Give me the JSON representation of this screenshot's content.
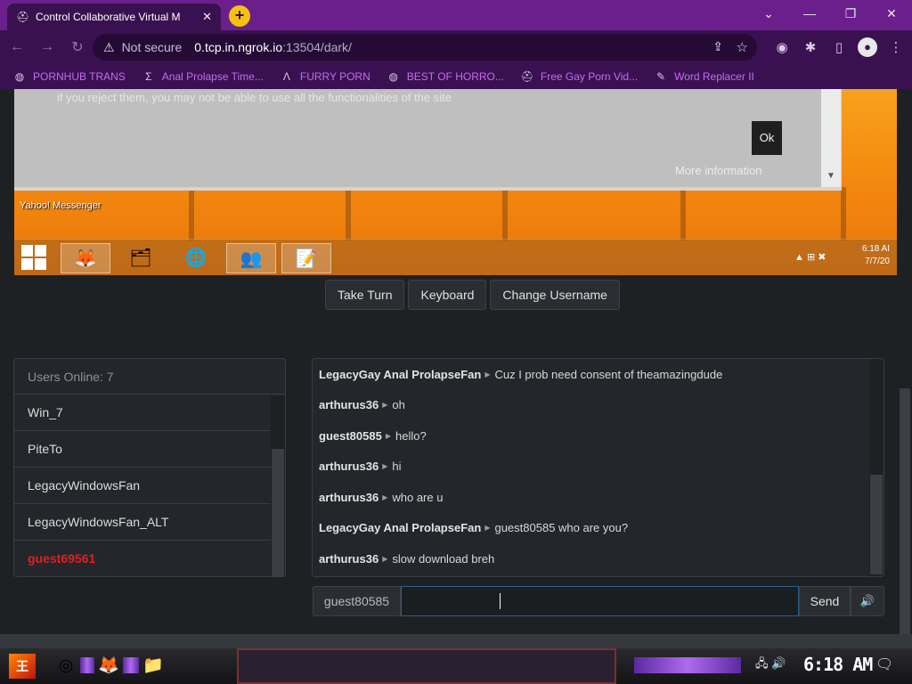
{
  "browser": {
    "tab_title": "Control Collaborative Virtual M",
    "tab_favicon": "hat-icon",
    "new_tab": "+",
    "window_controls": [
      "⌄",
      "—",
      "❐",
      "✕"
    ],
    "security": "Not secure",
    "url_host": "0.tcp.in.ngrok.io",
    "url_path": ":13504/dark/",
    "bookmarks": [
      {
        "label": "PORNHUB TRANS",
        "icon": "globe-icon"
      },
      {
        "label": "Anal Prolapse Time...",
        "icon": "sigma-icon"
      },
      {
        "label": "FURRY PORN",
        "icon": "lambda-icon"
      },
      {
        "label": "BEST OF HORRO...",
        "icon": "globe-icon"
      },
      {
        "label": "Free Gay Porn Vid...",
        "icon": "hat-icon"
      },
      {
        "label": "Word Replacer II",
        "icon": "wr-icon"
      }
    ]
  },
  "vm_screen": {
    "dialog_text": "if you reject them, you may not be able to use all the functionalities of the site",
    "ok_label": "Ok",
    "more_info": "More information",
    "desktop_icon_label": "Yahoo! Messenger",
    "clock_time": "6:18 AI",
    "clock_date": "7/7/20"
  },
  "controls": {
    "take_turn": "Take Turn",
    "keyboard": "Keyboard",
    "change_username": "Change Username"
  },
  "users": {
    "header": "Users Online: 7",
    "list": [
      "Win_7",
      "PiteTo",
      "LegacyWindowsFan",
      "LegacyWindowsFan_ALT",
      "guest69561"
    ]
  },
  "chat": {
    "messages": [
      {
        "user": "LegacyGay Anal ProlapseFan",
        "text": "Cuz I prob need consent of theamazingdude"
      },
      {
        "user": "arthurus36",
        "text": "oh"
      },
      {
        "user": "guest80585",
        "text": "hello?"
      },
      {
        "user": "arthurus36",
        "text": "hi"
      },
      {
        "user": "arthurus36",
        "text": "who are u"
      },
      {
        "user": "LegacyGay Anal ProlapseFan",
        "text": "guest80585 who are you?"
      },
      {
        "user": "arthurus36",
        "text": "slow download breh"
      }
    ],
    "username": "guest80585",
    "input_value": "",
    "send_label": "Send",
    "volume_icon": "🔊"
  },
  "host_taskbar": {
    "clock": "6:18 AM"
  },
  "colors": {
    "tabstrip": "#6b1f8c",
    "toolbar": "#3a1150",
    "bookmark_text": "#c46cf0",
    "self_user": "#e02020",
    "page_bg": "#1e2124"
  }
}
